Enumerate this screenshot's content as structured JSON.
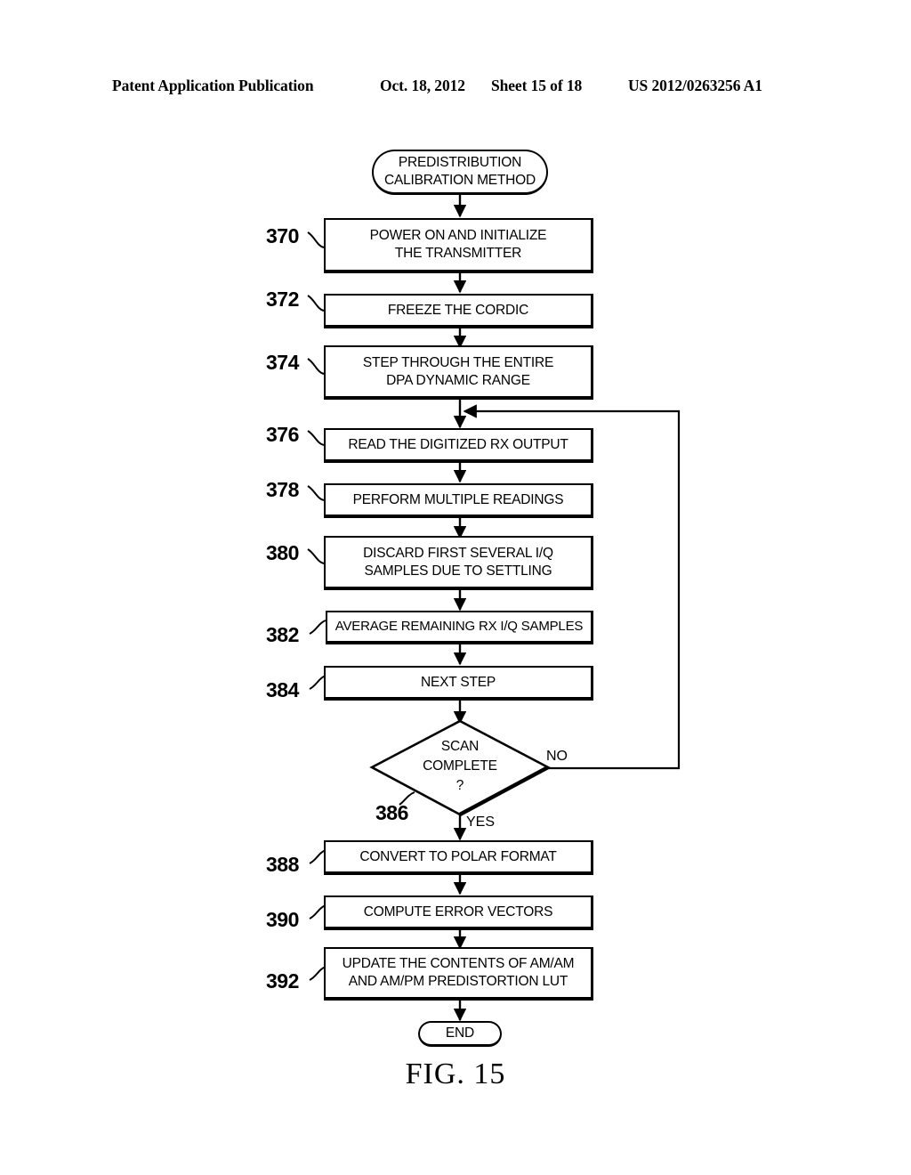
{
  "header": {
    "publication": "Patent Application Publication",
    "date": "Oct. 18, 2012",
    "sheet": "Sheet 15 of 18",
    "number": "US 2012/0263256 A1"
  },
  "figure": {
    "caption": "FIG. 15"
  },
  "flowchart": {
    "title": "PREDISTRIBUTION CALIBRATION METHOD",
    "start": {
      "label_line1": "PREDISTRIBUTION",
      "label_line2": "CALIBRATION METHOD"
    },
    "end": {
      "label": "END"
    },
    "steps": [
      {
        "ref": "370",
        "line1": "POWER ON AND INITIALIZE",
        "line2": "THE TRANSMITTER"
      },
      {
        "ref": "372",
        "line1": "FREEZE THE CORDIC",
        "line2": ""
      },
      {
        "ref": "374",
        "line1": "STEP THROUGH THE ENTIRE",
        "line2": "DPA DYNAMIC RANGE"
      },
      {
        "ref": "376",
        "line1": "READ THE DIGITIZED RX OUTPUT",
        "line2": ""
      },
      {
        "ref": "378",
        "line1": "PERFORM MULTIPLE READINGS",
        "line2": ""
      },
      {
        "ref": "380",
        "line1": "DISCARD FIRST SEVERAL I/Q",
        "line2": "SAMPLES DUE TO SETTLING"
      },
      {
        "ref": "382",
        "line1": "AVERAGE REMAINING RX I/Q SAMPLES",
        "line2": ""
      },
      {
        "ref": "384",
        "line1": "NEXT STEP",
        "line2": ""
      },
      {
        "ref": "388",
        "line1": "CONVERT TO POLAR FORMAT",
        "line2": ""
      },
      {
        "ref": "390",
        "line1": "COMPUTE ERROR VECTORS",
        "line2": ""
      },
      {
        "ref": "392",
        "line1": "UPDATE THE CONTENTS OF AM/AM",
        "line2": "AND AM/PM PREDISTORTION LUT"
      }
    ],
    "decision": {
      "ref": "386",
      "line1": "SCAN",
      "line2": "COMPLETE",
      "line3": "?",
      "branch_no": "NO",
      "branch_yes": "YES"
    }
  }
}
